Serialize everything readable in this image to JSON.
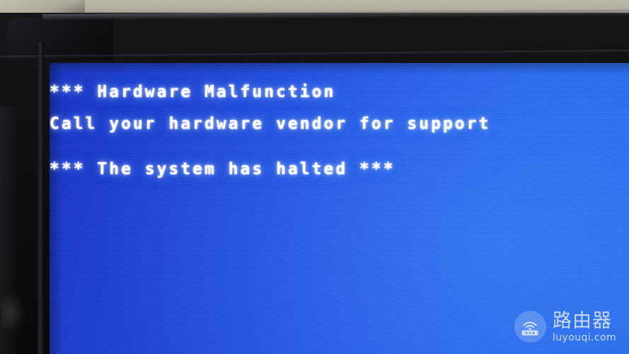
{
  "photo": {
    "subject": "monitor-hardware-malfunction-screen",
    "colors": {
      "screen_blue_left": "#1733c4",
      "screen_blue_right": "#2468ef",
      "bezel_black": "#0a0a0c",
      "wall_beige": "#b2afa0",
      "text_white": "#ffffff"
    }
  },
  "screen": {
    "lines": [
      {
        "id": "line-1",
        "text": "*** Hardware Malfunction"
      },
      {
        "id": "line-2",
        "text": "Call your hardware vendor for support"
      },
      {
        "id": "line-3",
        "text": "*** The system has halted ***"
      }
    ]
  },
  "watermark": {
    "icon": "router-wifi-icon",
    "brand_cn": "路由器",
    "brand_url": "luyouqi.com"
  }
}
